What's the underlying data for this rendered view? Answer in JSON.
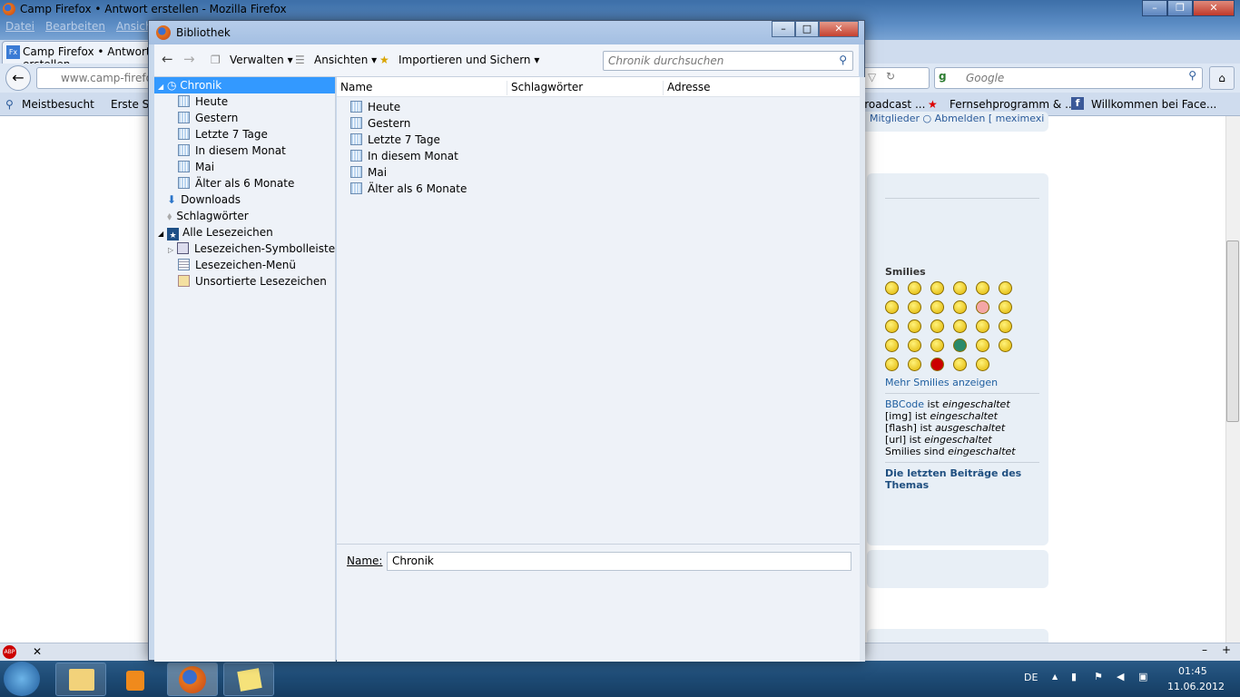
{
  "firefox": {
    "title": "Camp Firefox • Antwort erstellen - Mozilla Firefox",
    "menu": [
      "Datei",
      "Bearbeiten",
      "Ansicht"
    ],
    "tab": "Camp Firefox • Antwort erstellen",
    "url": "www.camp-firefox.de",
    "search_placeholder": "Google",
    "bookmarks": [
      "Meistbesucht",
      "Erste Schritte",
      "Broadcast ...",
      "Fernsehprogramm & ...",
      "Willkommen bei Face..."
    ],
    "page_fragment": "Mitglieder  ○ Abmelden [ meximexi ]"
  },
  "sidebar": {
    "smilies_title": "Smilies",
    "more_smilies": "Mehr Smilies anzeigen",
    "bbcode_link": "BBCode",
    "bbcode_rest": " ist ",
    "bbcode_state": "eingeschaltet",
    "status": [
      {
        "label": "[img] ist ",
        "state": "eingeschaltet"
      },
      {
        "label": "[flash] ist ",
        "state": "ausgeschaltet"
      },
      {
        "label": "[url] ist ",
        "state": "eingeschaltet"
      },
      {
        "label": "Smilies sind ",
        "state": "eingeschaltet"
      }
    ],
    "last_posts": "Die letzten Beiträge des Themas"
  },
  "library": {
    "title": "Bibliothek",
    "toolbar": {
      "manage": "Verwalten",
      "views": "Ansichten",
      "import": "Importieren und Sichern",
      "search_placeholder": "Chronik durchsuchen"
    },
    "tree": [
      {
        "label": "Chronik",
        "selected": true
      },
      {
        "label": "Heute"
      },
      {
        "label": "Gestern"
      },
      {
        "label": "Letzte 7 Tage"
      },
      {
        "label": "In diesem Monat"
      },
      {
        "label": "Mai"
      },
      {
        "label": "Älter als 6 Monate"
      },
      {
        "label": "Downloads"
      },
      {
        "label": "Schlagwörter"
      },
      {
        "label": "Alle Lesezeichen"
      },
      {
        "label": "Lesezeichen-Symbolleiste"
      },
      {
        "label": "Lesezeichen-Menü"
      },
      {
        "label": "Unsortierte Lesezeichen"
      }
    ],
    "columns": [
      "Name",
      "Schlagwörter",
      "Adresse"
    ],
    "rows": [
      "Heute",
      "Gestern",
      "Letzte 7 Tage",
      "In diesem Monat",
      "Mai",
      "Älter als 6 Monate"
    ],
    "name_label": "Name:",
    "name_value": "Chronik"
  },
  "taskbar": {
    "lang": "DE",
    "time": "01:45",
    "date": "11.06.2012"
  }
}
